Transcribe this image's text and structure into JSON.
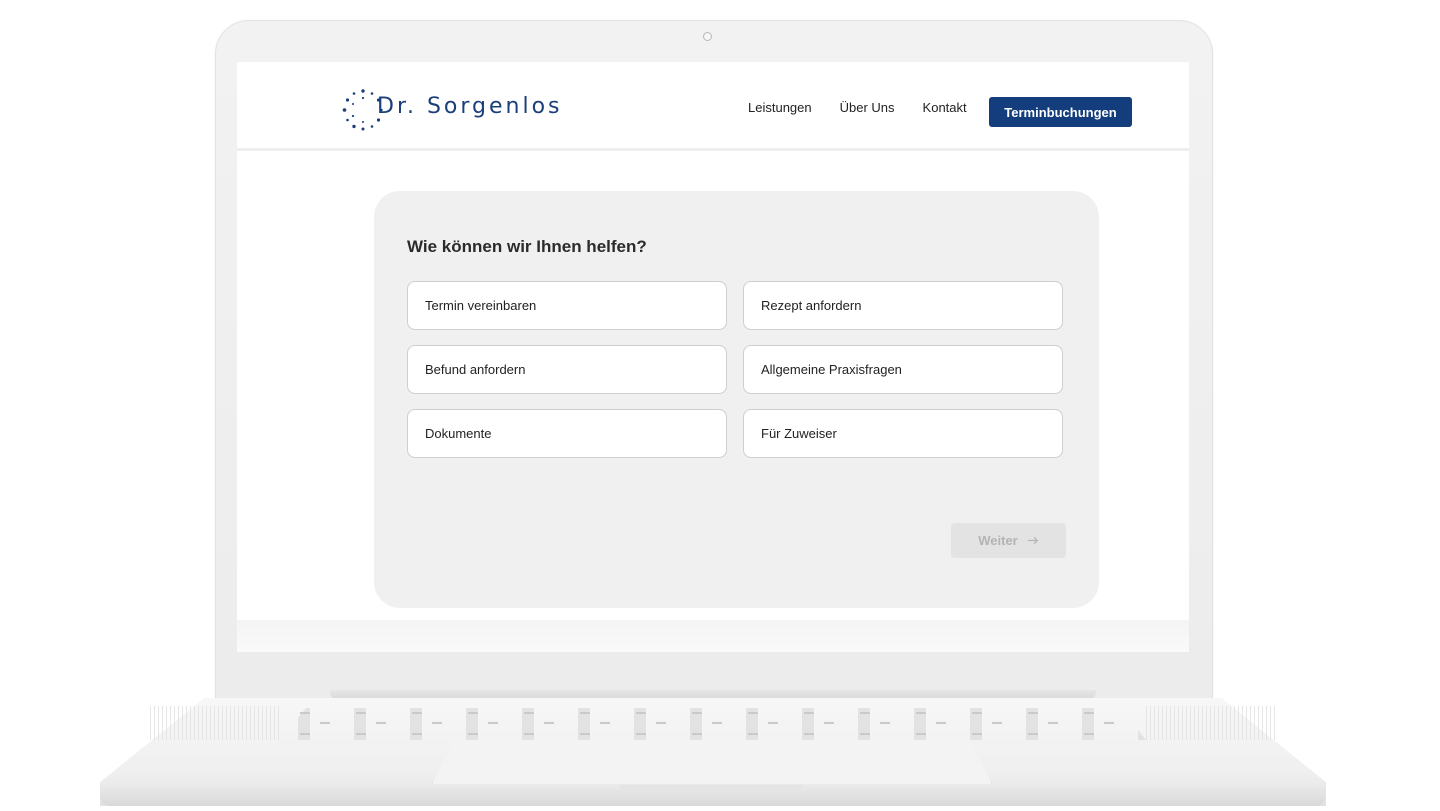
{
  "brand": {
    "name": "Dr. Sorgenlos",
    "color": "#1b3f7a"
  },
  "nav": {
    "items": [
      "Leistungen",
      "Über Uns",
      "Kontakt"
    ],
    "cta_label": "Terminbuchungen",
    "cta_color": "#133d7c"
  },
  "form": {
    "question": "Wie können wir Ihnen helfen?",
    "options": [
      "Termin vereinbaren",
      "Rezept anfordern",
      "Befund anfordern",
      "Allgemeine Praxisfragen",
      "Dokumente",
      "Für Zuweiser"
    ],
    "next_label": "Weiter",
    "next_icon": "arrow-right-icon",
    "next_enabled": false
  }
}
